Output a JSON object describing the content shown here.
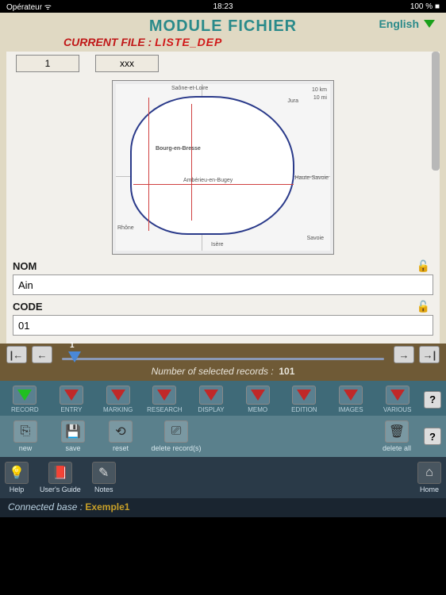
{
  "status": {
    "carrier": "Opérateur ᯤ",
    "time": "18:23",
    "battery": "100 % ■"
  },
  "header": {
    "title": "MODULE FICHIER",
    "langLabel": "English",
    "currentFileLabel": "CURRENT FILE :",
    "currentFileValue": "LISTE_DEP"
  },
  "form": {
    "topBoxes": [
      "1",
      "xxx"
    ],
    "mapLabels": {
      "top": "Saône-et-Loire",
      "right1": "Jura",
      "center": "Bourg-en-Bresse",
      "belowCenter": "Ambérieu-en-Bugey",
      "rightSide": "Haute-Savoie",
      "bottomLeft": "Rhône",
      "bottom": "Isère",
      "bottomRight": "Savoie",
      "scale1": "10 km",
      "scale2": "10 mi"
    },
    "fields": [
      {
        "label": "NOM",
        "value": "Ain"
      },
      {
        "label": "CODE",
        "value": "01"
      }
    ]
  },
  "slider": {
    "nav": {
      "first": "|←",
      "prev": "←",
      "next": "→",
      "last": "→|"
    },
    "posLabel": "1",
    "recordCountLabel": "Number of selected records :",
    "recordCountValue": "101"
  },
  "tabs": [
    {
      "label": "RECORD",
      "active": true
    },
    {
      "label": "ENTRY"
    },
    {
      "label": "MARKING"
    },
    {
      "label": "RESEARCH"
    },
    {
      "label": "DISPLAY"
    },
    {
      "label": "MEMO"
    },
    {
      "label": "EDITION"
    },
    {
      "label": "IMAGES"
    },
    {
      "label": "VARIOUS"
    }
  ],
  "helpMark": "?",
  "actions": {
    "left": [
      {
        "label": "new",
        "icon": "⎘"
      },
      {
        "label": "save",
        "icon": "💾"
      },
      {
        "label": "reset",
        "icon": "⟲"
      },
      {
        "label": "delete record(s)",
        "icon": "⎚"
      }
    ],
    "right": [
      {
        "label": "delete all",
        "icon": "🗑"
      }
    ]
  },
  "bottomNav": {
    "left": [
      {
        "label": "Help",
        "icon": "💡"
      },
      {
        "label": "User's Guide",
        "icon": "📕"
      },
      {
        "label": "Notes",
        "icon": "✎"
      }
    ],
    "right": [
      {
        "label": "Home",
        "icon": "⌂"
      }
    ]
  },
  "footer": {
    "label": "Connected base :",
    "value": "Exemple1"
  }
}
